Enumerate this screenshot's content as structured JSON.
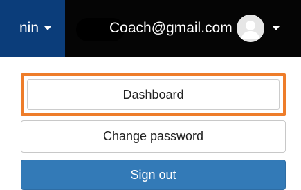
{
  "navbar": {
    "admin_label": "nin",
    "user_email": "Coach@gmail.com"
  },
  "dropdown": {
    "dashboard_label": "Dashboard",
    "change_password_label": "Change password",
    "sign_out_label": "Sign out"
  },
  "colors": {
    "navbar_bg": "#050505",
    "admin_bg": "#0b3d7a",
    "highlight_border": "#ee7d2a",
    "sign_out_bg": "#337ab7"
  },
  "icons": {
    "avatar": "user-avatar-icon",
    "caret": "caret-down-icon"
  }
}
